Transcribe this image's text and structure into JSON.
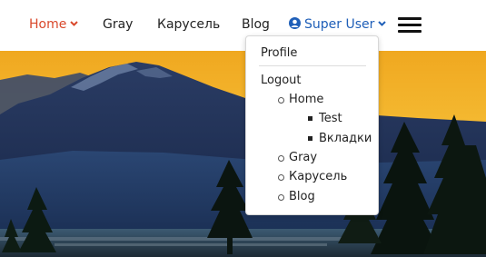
{
  "nav": {
    "items": [
      {
        "label": "Home",
        "active": true
      },
      {
        "label": "Gray"
      },
      {
        "label": "Карусель"
      },
      {
        "label": "Blog"
      }
    ],
    "user_label": "Super User",
    "active_color": "#d9482b",
    "user_color": "#1f5fb8"
  },
  "dropdown": {
    "profile_label": "Profile",
    "logout_label": "Logout",
    "submenu": [
      {
        "label": "Home",
        "children": [
          {
            "label": "Test"
          },
          {
            "label": "Вкладки"
          }
        ]
      },
      {
        "label": "Gray"
      },
      {
        "label": "Карусель"
      },
      {
        "label": "Blog"
      }
    ]
  },
  "icons": {
    "user": "user-circle-icon",
    "caret": "chevron-down-icon",
    "menu": "hamburger-menu-icon"
  }
}
